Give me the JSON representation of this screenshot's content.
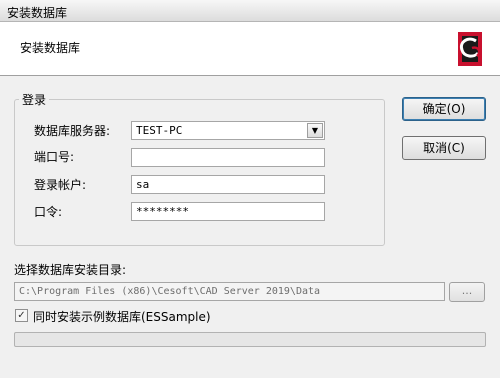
{
  "window": {
    "title": "安装数据库"
  },
  "header": {
    "title": "安装数据库",
    "logo_icon": "cesoft-logo-icon"
  },
  "login": {
    "legend": "登录",
    "server_label": "数据库服务器:",
    "server_value": "TEST-PC",
    "port_label": "端口号:",
    "port_value": "",
    "account_label": "登录帐户:",
    "account_value": "sa",
    "password_label": "口令:",
    "password_value": "********"
  },
  "buttons": {
    "ok_label": "确定(O)",
    "cancel_label": "取消(C)",
    "browse_label": "..."
  },
  "install": {
    "dir_label": "选择数据库安装目录:",
    "dir_value": "C:\\Program Files (x86)\\Cesoft\\CAD Server 2019\\Data",
    "sample_checked": true,
    "sample_label": "同时安装示例数据库(ESSample)",
    "progress": 0
  },
  "colors": {
    "logo_red": "#c8102e",
    "default_button_border": "#2c628b"
  }
}
